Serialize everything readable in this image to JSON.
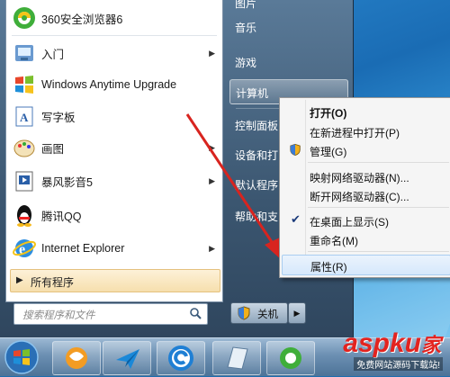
{
  "start_menu": {
    "programs": [
      {
        "label": "360安全浏览器6",
        "icon": "360-browser-icon",
        "has_submenu": false
      },
      {
        "label": "入门",
        "icon": "getting-started-icon",
        "has_submenu": true
      },
      {
        "label": "Windows Anytime Upgrade",
        "icon": "windows-upgrade-icon",
        "has_submenu": false
      },
      {
        "label": "写字板",
        "icon": "wordpad-icon",
        "has_submenu": false
      },
      {
        "label": "画图",
        "icon": "paint-icon",
        "has_submenu": true
      },
      {
        "label": "暴风影音5",
        "icon": "baofeng-player-icon",
        "has_submenu": true
      },
      {
        "label": "腾讯QQ",
        "icon": "qq-penguin-icon",
        "has_submenu": false
      },
      {
        "label": "Internet Explorer",
        "icon": "internet-explorer-icon",
        "has_submenu": true
      }
    ],
    "all_programs": "所有程序",
    "search_placeholder": "搜索程序和文件",
    "right_items": [
      {
        "label": "音乐"
      },
      {
        "label": "游戏"
      },
      {
        "label": "计算机"
      },
      {
        "label": "控制面板"
      },
      {
        "label": "设备和打"
      },
      {
        "label": "默认程序"
      },
      {
        "label": "帮助和支"
      }
    ],
    "top_partial": "图片",
    "shutdown_label": "关机"
  },
  "context_menu": {
    "items": [
      {
        "label": "打开(O)",
        "bold": true
      },
      {
        "label": "在新进程中打开(P)"
      },
      {
        "label": "管理(G)",
        "icon": "uac-shield-icon"
      },
      {
        "separator": true
      },
      {
        "label": "映射网络驱动器(N)..."
      },
      {
        "label": "断开网络驱动器(C)..."
      },
      {
        "separator": true
      },
      {
        "label": "在桌面上显示(S)",
        "checked": true
      },
      {
        "label": "重命名(M)"
      },
      {
        "separator": true
      },
      {
        "label": "属性(R)",
        "highlighted": true
      }
    ]
  },
  "watermark": {
    "brand": "aspku",
    "brand_suffix": "家",
    "sub": "免费网站源码下载站!"
  },
  "colors": {
    "accent_red": "#e3231f",
    "menu_highlight": "#d6e8fb"
  }
}
